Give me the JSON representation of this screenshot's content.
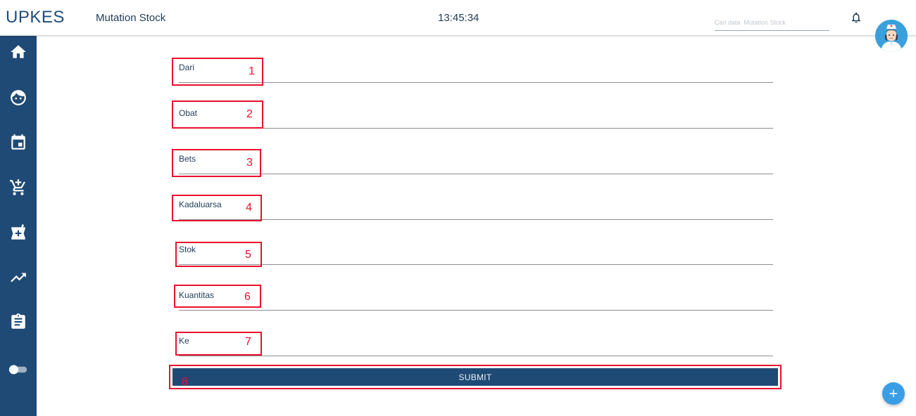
{
  "header": {
    "brand": "UPKES",
    "title": "Mutation Stock",
    "time": "13:45:34",
    "search_placeholder": "Cari data  Mutation Stock"
  },
  "sidebar": {
    "items": [
      {
        "icon": "home-icon"
      },
      {
        "icon": "face-icon"
      },
      {
        "icon": "calendar-icon"
      },
      {
        "icon": "add-cart-icon"
      },
      {
        "icon": "medical-bag-icon"
      },
      {
        "icon": "trending-up-icon"
      },
      {
        "icon": "clipboard-icon"
      },
      {
        "icon": "toggle-icon"
      }
    ]
  },
  "form": {
    "fields": [
      {
        "label": "Dari",
        "marker": "1"
      },
      {
        "label": "Obat",
        "marker": "2"
      },
      {
        "label": "Bets",
        "marker": "3"
      },
      {
        "label": "Kadaluarsa",
        "marker": "4"
      },
      {
        "label": "Stok",
        "marker": "5"
      },
      {
        "label": "Kuantitas",
        "marker": "6"
      },
      {
        "label": "Ke",
        "marker": "7"
      }
    ],
    "submit_label": "SUBMIT",
    "submit_marker": "8"
  },
  "fab": {
    "icon": "plus-icon"
  },
  "colors": {
    "primary": "#1f4a75",
    "annotation": "#e8102e",
    "fab": "#3a9ee6"
  }
}
